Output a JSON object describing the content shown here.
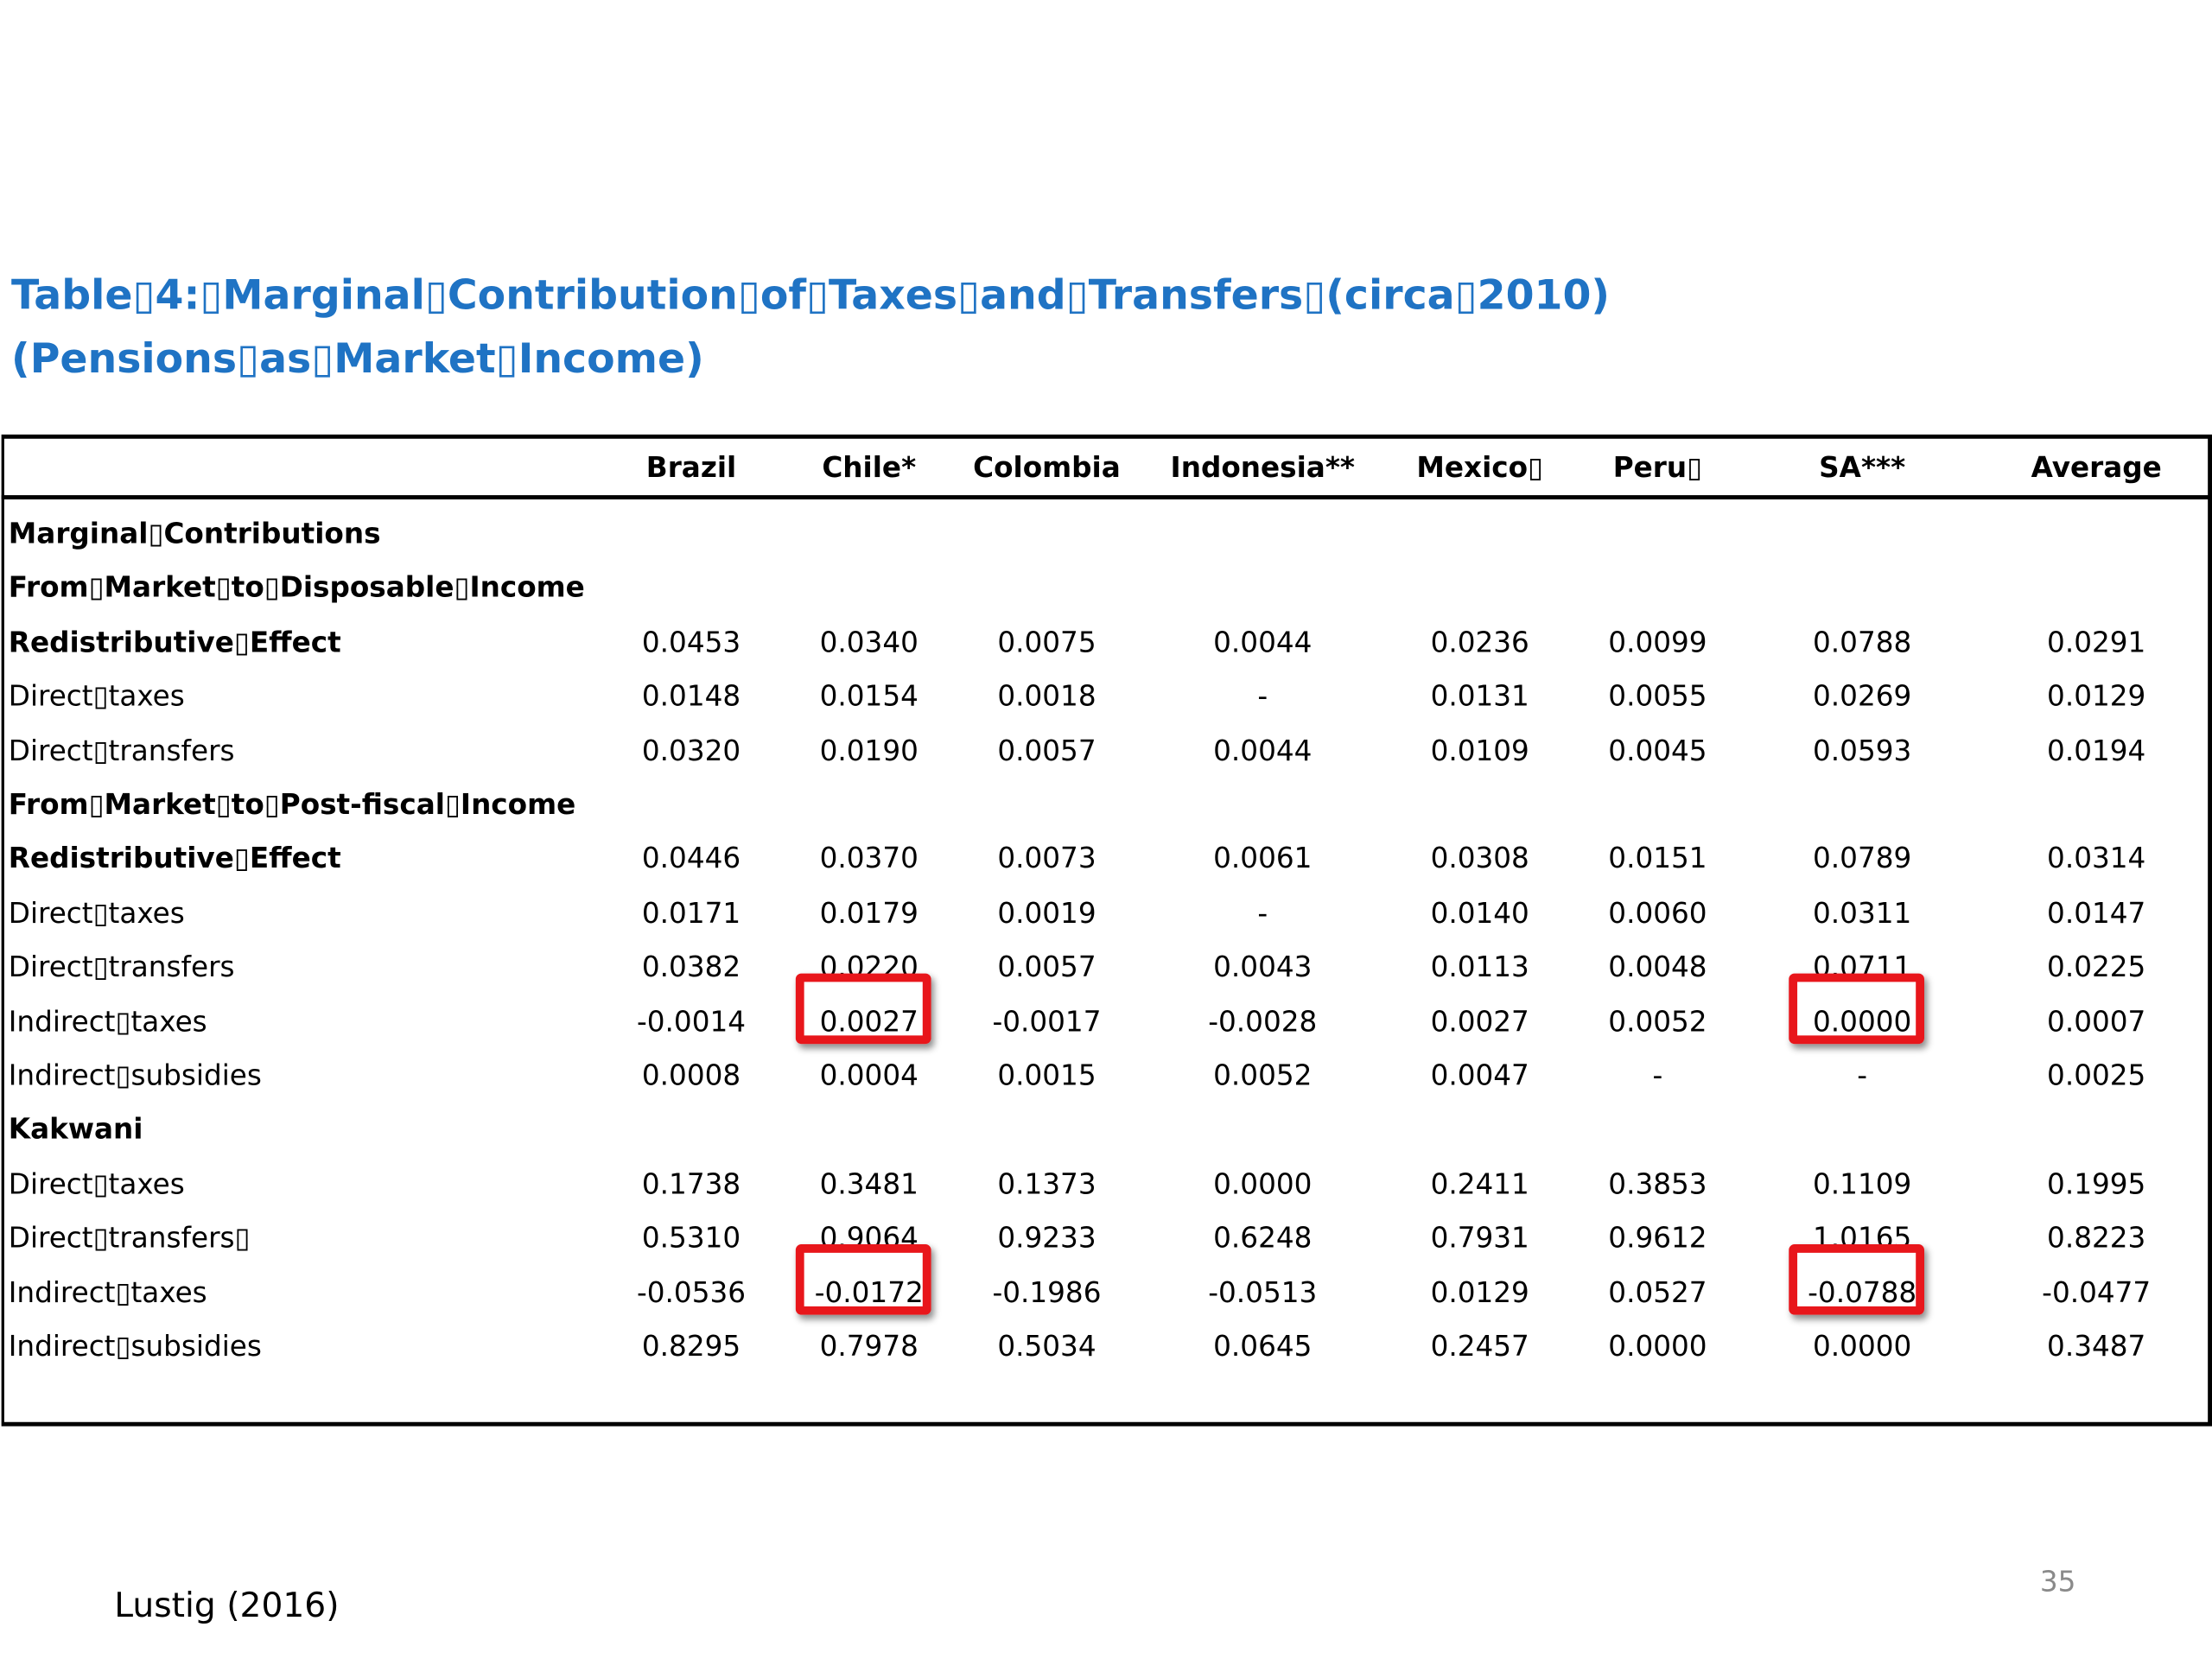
{
  "title": {
    "line1": "Table▯4:▯Marginal▯Contribution▯of▯Taxes▯and▯Transfers▯(circa▯2010)",
    "line2": "(Pensions▯as▯Market▯Income)"
  },
  "table": {
    "columns": [
      "Brazil",
      "Chile*",
      "Colombia",
      "Indonesia**",
      "Mexico▯",
      "Peru▯",
      "SA***",
      "Average"
    ],
    "rows": [
      {
        "label": "Marginal▯Contributions",
        "bold": true,
        "values": []
      },
      {
        "label": "From▯Market▯to▯Disposable▯Income",
        "bold": true,
        "values": []
      },
      {
        "label": "Redistributive▯Effect",
        "bold": true,
        "values": [
          "0.0453",
          "0.0340",
          "0.0075",
          "0.0044",
          "0.0236",
          "0.0099",
          "0.0788",
          "0.0291"
        ]
      },
      {
        "label": "Direct▯taxes",
        "bold": false,
        "values": [
          "0.0148",
          "0.0154",
          "0.0018",
          "-",
          "0.0131",
          "0.0055",
          "0.0269",
          "0.0129"
        ]
      },
      {
        "label": "Direct▯transfers",
        "bold": false,
        "values": [
          "0.0320",
          "0.0190",
          "0.0057",
          "0.0044",
          "0.0109",
          "0.0045",
          "0.0593",
          "0.0194"
        ]
      },
      {
        "label": "From▯Market▯to▯Post-fiscal▯Income",
        "bold": true,
        "values": []
      },
      {
        "label": "Redistributive▯Effect",
        "bold": true,
        "values": [
          "0.0446",
          "0.0370",
          "0.0073",
          "0.0061",
          "0.0308",
          "0.0151",
          "0.0789",
          "0.0314"
        ]
      },
      {
        "label": "Direct▯taxes",
        "bold": false,
        "values": [
          "0.0171",
          "0.0179",
          "0.0019",
          "-",
          "0.0140",
          "0.0060",
          "0.0311",
          "0.0147"
        ]
      },
      {
        "label": "Direct▯transfers",
        "bold": false,
        "values": [
          "0.0382",
          "0.0220",
          "0.0057",
          "0.0043",
          "0.0113",
          "0.0048",
          "0.0711",
          "0.0225"
        ]
      },
      {
        "label": "Indirect▯taxes",
        "bold": false,
        "values": [
          "-0.0014",
          "0.0027",
          "-0.0017",
          "-0.0028",
          "0.0027",
          "0.0052",
          "0.0000",
          "0.0007"
        ]
      },
      {
        "label": "Indirect▯subsidies",
        "bold": false,
        "values": [
          "0.0008",
          "0.0004",
          "0.0015",
          "0.0052",
          "0.0047",
          "-",
          "-",
          "0.0025"
        ]
      },
      {
        "label": "Kakwani",
        "bold": true,
        "values": []
      },
      {
        "label": "Direct▯taxes",
        "bold": false,
        "values": [
          "0.1738",
          "0.3481",
          "0.1373",
          "0.0000",
          "0.2411",
          "0.3853",
          "0.1109",
          "0.1995"
        ]
      },
      {
        "label": "Direct▯transfers▯",
        "bold": false,
        "values": [
          "0.5310",
          "0.9064",
          "0.9233",
          "0.6248",
          "0.7931",
          "0.9612",
          "1.0165",
          "0.8223"
        ]
      },
      {
        "label": "Indirect▯taxes",
        "bold": false,
        "values": [
          "-0.0536",
          "-0.0172",
          "-0.1986",
          "-0.0513",
          "0.0129",
          "0.0527",
          "-0.0788",
          "-0.0477"
        ]
      },
      {
        "label": "Indirect▯subsidies",
        "bold": false,
        "values": [
          "0.8295",
          "0.7978",
          "0.5034",
          "0.0645",
          "0.2457",
          "0.0000",
          "0.0000",
          "0.3487"
        ]
      }
    ]
  },
  "highlights": [
    {
      "row": 9,
      "col": 1
    },
    {
      "row": 9,
      "col": 6
    },
    {
      "row": 14,
      "col": 1
    },
    {
      "row": 14,
      "col": 6
    }
  ],
  "highlight_color": "#e8161b",
  "title_color": "#1f73c4",
  "citation": "Lustig (2016)",
  "slide_number": "35"
}
